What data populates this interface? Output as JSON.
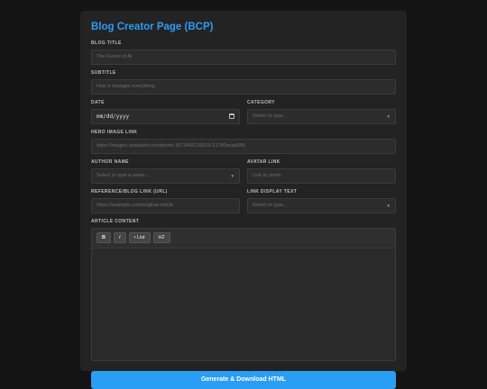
{
  "page": {
    "title": "Blog Creator Page (BCP)"
  },
  "form": {
    "blog_title": {
      "label": "BLOG TITLE",
      "placeholder": "The Future of AI"
    },
    "subtitle": {
      "label": "SUBTITLE",
      "placeholder": "How it changes everything"
    },
    "date": {
      "label": "DATE",
      "value": "mm/dd/yyyy"
    },
    "category": {
      "label": "CATEGORY",
      "placeholder": "Select or type..."
    },
    "hero_image": {
      "label": "HERO IMAGE LINK",
      "placeholder": "https://images.unsplash.com/photo-1677442136019-21780ecad995"
    },
    "author_name": {
      "label": "AUTHOR NAME",
      "placeholder": "Select or type a name..."
    },
    "avatar_link": {
      "label": "AVATAR LINK",
      "placeholder": "Link to photo"
    },
    "reference_link": {
      "label": "REFERENCE/BLOG LINK (URL)",
      "placeholder": "https://example.com/original-article"
    },
    "link_display_text": {
      "label": "LINK DISPLAY TEXT",
      "placeholder": "Select or type..."
    },
    "article_content": {
      "label": "ARTICLE CONTENT",
      "toolbar": [
        "B",
        "I",
        "• List",
        "H2"
      ]
    }
  },
  "submit_label": "Generate & Download HTML"
}
